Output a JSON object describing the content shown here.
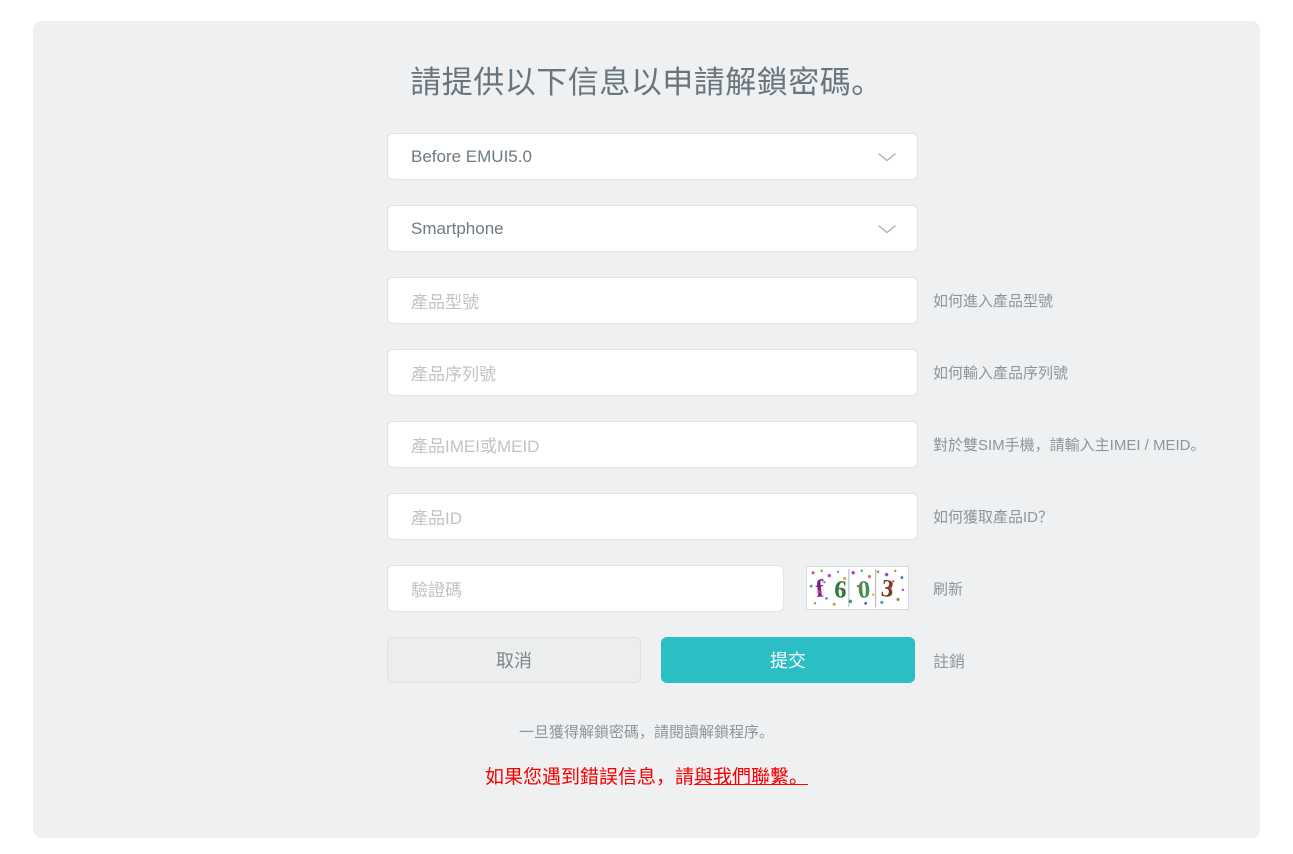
{
  "page": {
    "title": "請提供以下信息以申請解鎖密碼。",
    "card_bg": "#eff0f1",
    "accent_color": "#2bbfc5",
    "error_color": "#fa0000"
  },
  "form": {
    "device_version_select": {
      "value": "Before EMUI5.0",
      "icon": "chevron-down-icon"
    },
    "device_type_select": {
      "value": "Smartphone",
      "icon": "chevron-down-icon"
    },
    "product_model": {
      "value": "",
      "placeholder": "產品型號",
      "hint": "如何進入產品型號"
    },
    "serial_number": {
      "value": "",
      "placeholder": "產品序列號",
      "hint": "如何輸入產品序列號"
    },
    "imei": {
      "value": "",
      "placeholder": "產品IMEI或MEID",
      "hint": "對於雙SIM手機，請輸入主IMEI / MEID。"
    },
    "product_id": {
      "value": "",
      "placeholder": "產品ID",
      "hint": "如何獲取產品ID？"
    },
    "captcha": {
      "value": "",
      "placeholder": "驗證碼",
      "refresh_label": "刷新",
      "image_text": "f603",
      "image_chars": [
        {
          "char": "f",
          "color": "#7b1f8e"
        },
        {
          "char": "6",
          "color": "#2f7a2f"
        },
        {
          "char": "0",
          "color": "#3f8f4f"
        },
        {
          "char": "3",
          "color": "#7a3b1e"
        }
      ]
    }
  },
  "actions": {
    "cancel_label": "取消",
    "submit_label": "提交",
    "logout_label": "註銷"
  },
  "footer": {
    "note": "一旦獲得解鎖密碼，請閱讀解鎖程序。",
    "error_prefix": "如果您遇到錯誤信息，請",
    "error_link": "與我們聯繫。"
  }
}
